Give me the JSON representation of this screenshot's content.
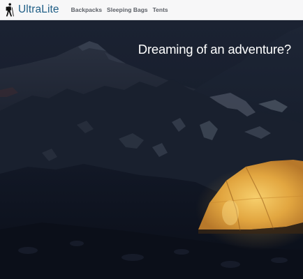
{
  "app": {
    "brand_name": "UltraLite",
    "brand_icon": "hiker-icon"
  },
  "nav": {
    "items": [
      {
        "label": "Backpacks"
      },
      {
        "label": "Sleeping Bags"
      },
      {
        "label": "Tents"
      }
    ]
  },
  "hero": {
    "headline": "Dreaming of an adventure?",
    "image": "night-mountain-camp-tent-photo"
  },
  "colors": {
    "brand": "#1f5e86",
    "nav_background": "#f7f7f8",
    "nav_link": "#5b5f66",
    "tent_glow": "#f0b94a",
    "night_sky": "#1a2232"
  }
}
